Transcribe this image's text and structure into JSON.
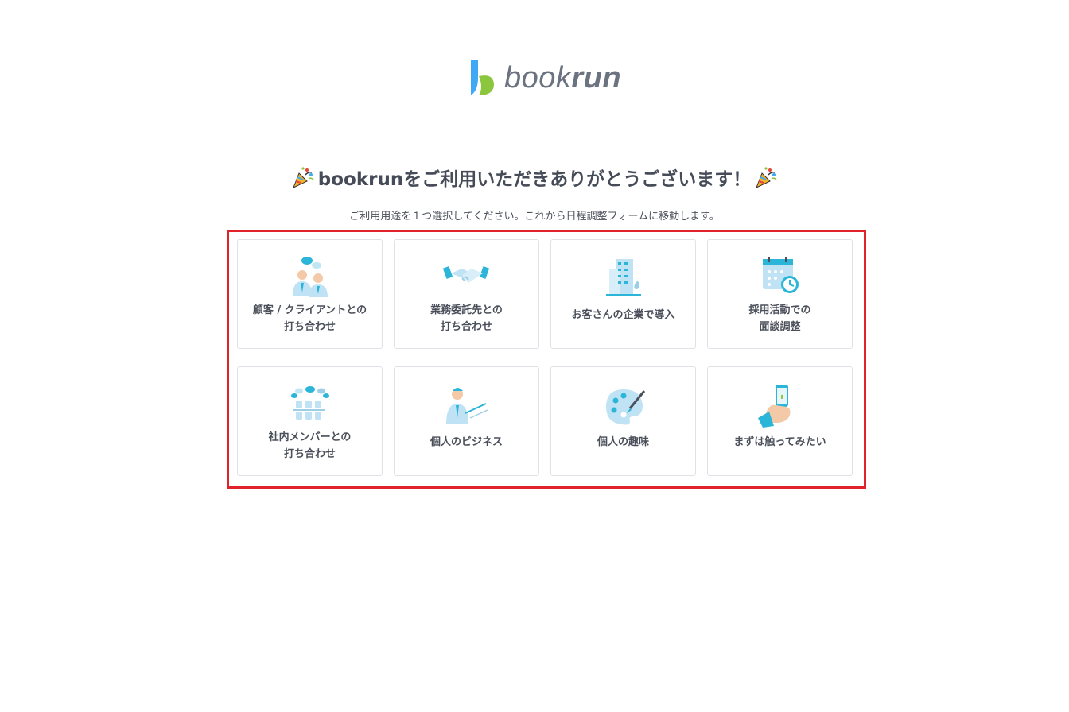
{
  "brand": {
    "name_part1": "book",
    "name_part2": "run",
    "blue": "#3fa9f5",
    "green": "#8cc63f"
  },
  "headline": {
    "text": "bookrunをご利用いただきありがとうございます！",
    "icon": "party-popper-icon"
  },
  "subtitle": "ご利用用途を１つ選択してください。これから日程調整フォームに移動します。",
  "highlight_color": "#e0222b",
  "options": [
    {
      "label": "顧客 / クライアントとの\n打ち合わせ",
      "icon": "client-meeting-icon"
    },
    {
      "label": "業務委託先との\n打ち合わせ",
      "icon": "handshake-icon"
    },
    {
      "label": "お客さんの企業で導入",
      "icon": "office-building-icon"
    },
    {
      "label": "採用活動での\n面談調整",
      "icon": "calendar-clock-icon"
    },
    {
      "label": "社内メンバーとの\n打ち合わせ",
      "icon": "team-meeting-icon"
    },
    {
      "label": "個人のビジネス",
      "icon": "presenter-icon"
    },
    {
      "label": "個人の趣味",
      "icon": "palette-icon"
    },
    {
      "label": "まずは触ってみたい",
      "icon": "hand-smartphone-icon"
    }
  ]
}
